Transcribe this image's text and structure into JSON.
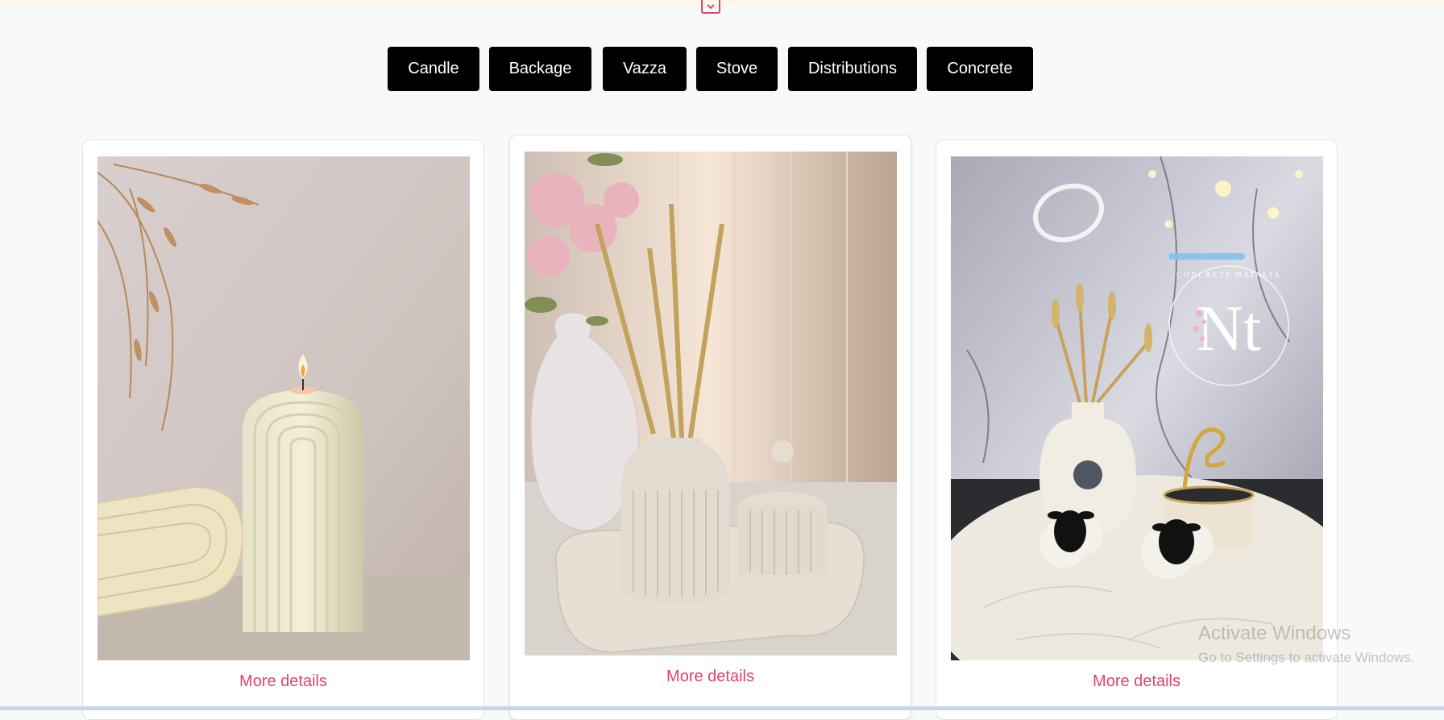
{
  "categories": [
    "Candle",
    "Backage",
    "Vazza",
    "Stove",
    "Distributions",
    "Concrete"
  ],
  "products": [
    {
      "image_icon": "arch-candle-photo",
      "link": "More details"
    },
    {
      "image_icon": "reed-diffuser-photo",
      "link": "More details"
    },
    {
      "image_icon": "eid-tray-photo",
      "link": "More details"
    }
  ],
  "logo": {
    "initials": "Nt",
    "ring_text": "CONCRETE NATALIA"
  },
  "watermark": {
    "title": "Activate Windows",
    "subtitle": "Go to Settings to activate Windows."
  },
  "colors": {
    "button_bg": "#000000",
    "link": "#e0446a",
    "page_bg": "#f8f9fb"
  }
}
